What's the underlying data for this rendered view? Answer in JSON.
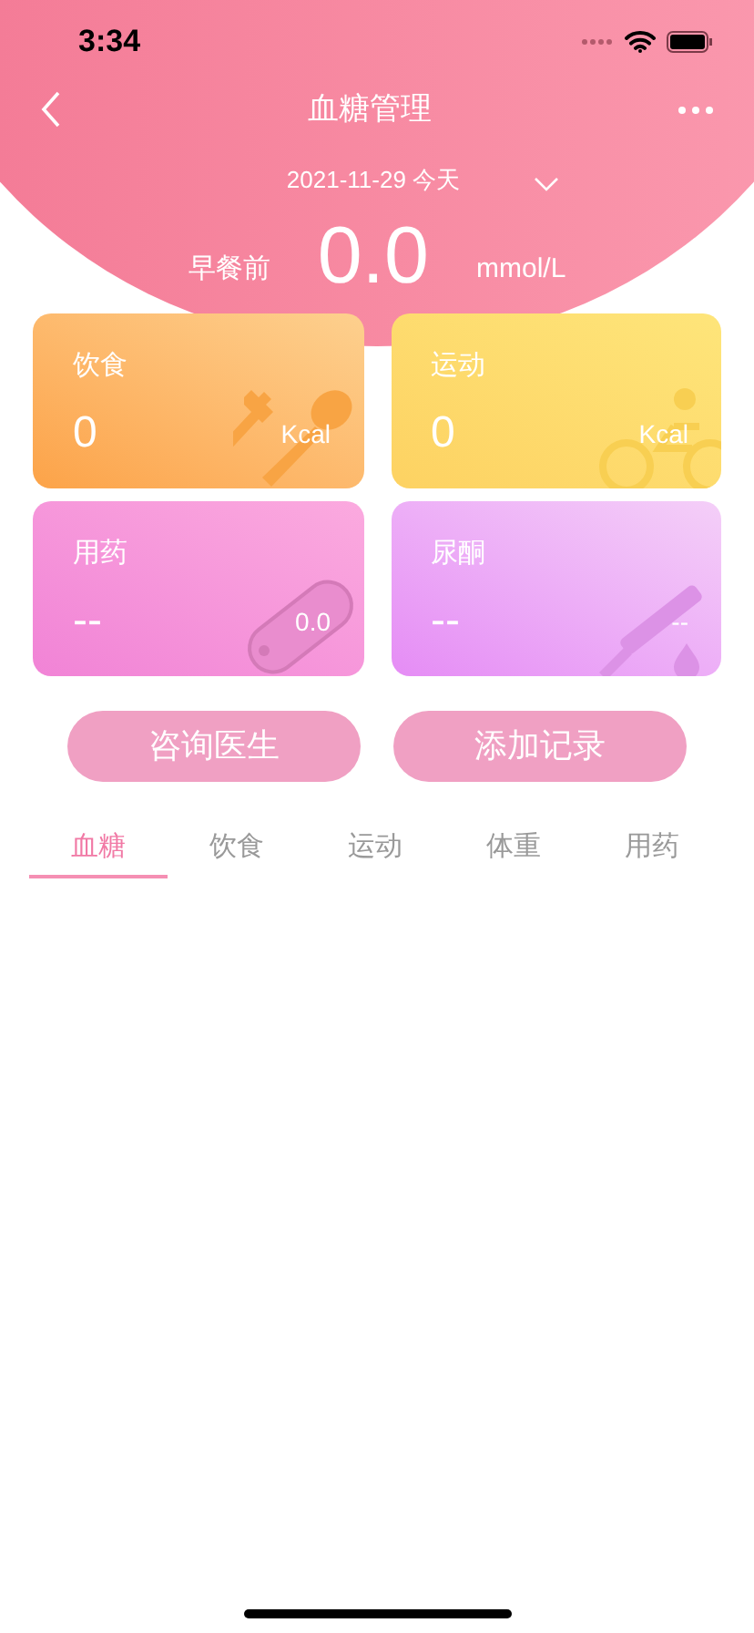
{
  "status_bar": {
    "time": "3:34"
  },
  "nav": {
    "title": "血糖管理"
  },
  "date": {
    "text": "2021-11-29 今天"
  },
  "reading": {
    "label": "早餐前",
    "value": "0.0",
    "unit": "mmol/L"
  },
  "cards": [
    {
      "kind": "food",
      "title": "饮食",
      "value": "0",
      "unit": "Kcal"
    },
    {
      "kind": "exercise",
      "title": "运动",
      "value": "0",
      "unit": "Kcal"
    },
    {
      "kind": "medicine",
      "title": "用药",
      "value": "--",
      "unit": "0.0"
    },
    {
      "kind": "ketone",
      "title": "尿酮",
      "value": "--",
      "unit": "--"
    }
  ],
  "buttons": [
    "咨询医生",
    "添加记录"
  ],
  "tabs": [
    {
      "label": "血糖",
      "selected": true
    },
    {
      "label": "饮食",
      "selected": false
    },
    {
      "label": "运动",
      "selected": false
    },
    {
      "label": "体重",
      "selected": false
    },
    {
      "label": "用药",
      "selected": false
    }
  ]
}
